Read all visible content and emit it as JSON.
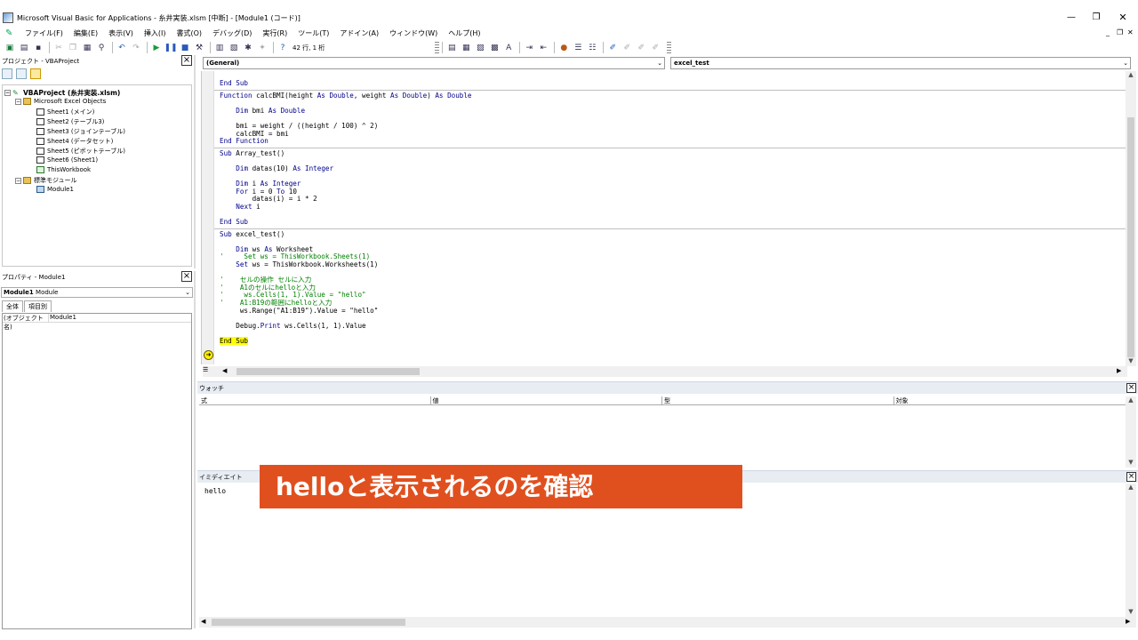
{
  "window": {
    "title": "Microsoft Visual Basic for Applications - 糸井実装.xlsm [中断] - [Module1 (コード)]",
    "min": "—",
    "max": "❐",
    "close": "✕"
  },
  "menu": {
    "items": [
      "ファイル(F)",
      "編集(E)",
      "表示(V)",
      "挿入(I)",
      "書式(O)",
      "デバッグ(D)",
      "実行(R)",
      "ツール(T)",
      "アドイン(A)",
      "ウィンドウ(W)",
      "ヘルプ(H)"
    ],
    "mdi_min": "_",
    "mdi_restore": "❐",
    "mdi_close": "✕"
  },
  "toolbar": {
    "position": "42 行, 1 桁"
  },
  "project": {
    "header": "プロジェクト - VBAProject",
    "root": "VBAProject (糸井実装.xlsm)",
    "excel_objects": "Microsoft Excel Objects",
    "sheets": [
      "Sheet1 (メイン)",
      "Sheet2 (テーブル3)",
      "Sheet3 (ジョインテーブル)",
      "Sheet4 (データセット)",
      "Sheet5 (ピボットテーブル)",
      "Sheet6 (Sheet1)"
    ],
    "workbook": "ThisWorkbook",
    "modules_folder": "標準モジュール",
    "module": "Module1"
  },
  "properties": {
    "header": "プロパティ - Module1",
    "object_name": "Module1",
    "object_type": "Module",
    "tab_all": "全体",
    "tab_category": "項目別",
    "row_key": "(オブジェクト名)",
    "row_value": "Module1"
  },
  "code": {
    "combo_object": "(General)",
    "combo_proc": "excel_test"
  },
  "watch": {
    "title": "ウォッチ",
    "cols": [
      "式",
      "値",
      "型",
      "対象"
    ]
  },
  "immediate": {
    "title": "イミディエイト",
    "output": "hello"
  },
  "caption": "helloと表示されるのを確認"
}
